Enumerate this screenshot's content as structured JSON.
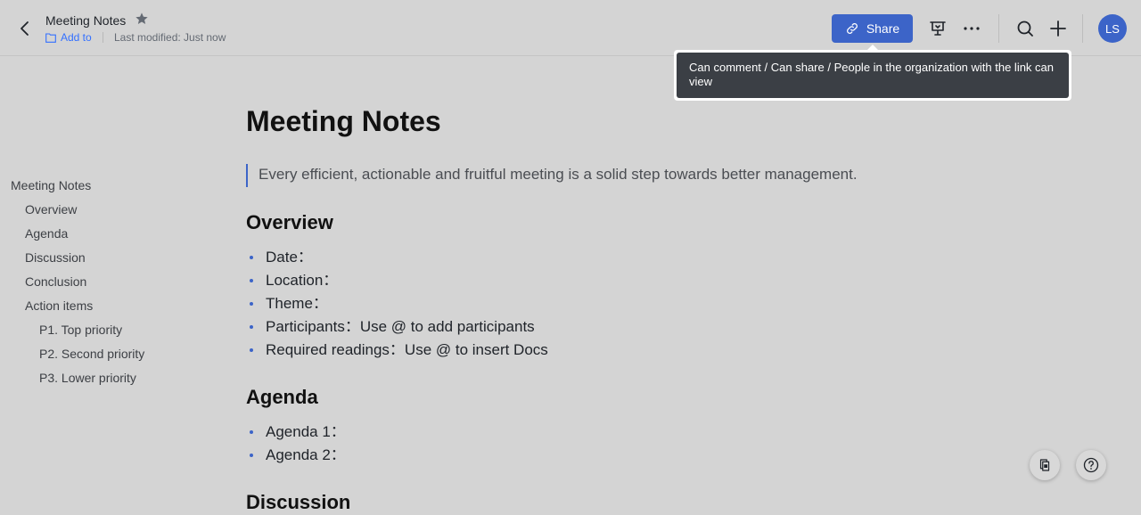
{
  "header": {
    "title": "Meeting Notes",
    "add_to": "Add to",
    "last_modified": "Last modified: Just now",
    "share_label": "Share",
    "avatar_initials": "LS"
  },
  "tooltip": {
    "text": "Can comment / Can share / People in the organization with the link can view"
  },
  "outline": {
    "items": [
      {
        "label": "Meeting Notes",
        "level": 1
      },
      {
        "label": "Overview",
        "level": 2
      },
      {
        "label": "Agenda",
        "level": 2
      },
      {
        "label": "Discussion",
        "level": 2
      },
      {
        "label": "Conclusion",
        "level": 2
      },
      {
        "label": "Action items",
        "level": 2
      },
      {
        "label": "P1. Top priority",
        "level": 3
      },
      {
        "label": "P2. Second priority",
        "level": 3
      },
      {
        "label": "P3. Lower priority",
        "level": 3
      }
    ]
  },
  "doc": {
    "title": "Meeting Notes",
    "quote": "Every efficient, actionable and fruitful meeting is a solid step towards better management.",
    "overview": {
      "heading": "Overview",
      "items": [
        "Date：",
        "Location：",
        "Theme：",
        "Participants：Use @ to add participants",
        "Required readings：Use @ to insert Docs"
      ]
    },
    "agenda": {
      "heading": "Agenda",
      "items": [
        "Agenda 1：",
        "Agenda 2："
      ]
    },
    "discussion": {
      "heading": "Discussion"
    }
  },
  "colors": {
    "accent": "#3c64c8",
    "background": "#d4d4d4",
    "tooltip_bg": "#3b3f45"
  }
}
